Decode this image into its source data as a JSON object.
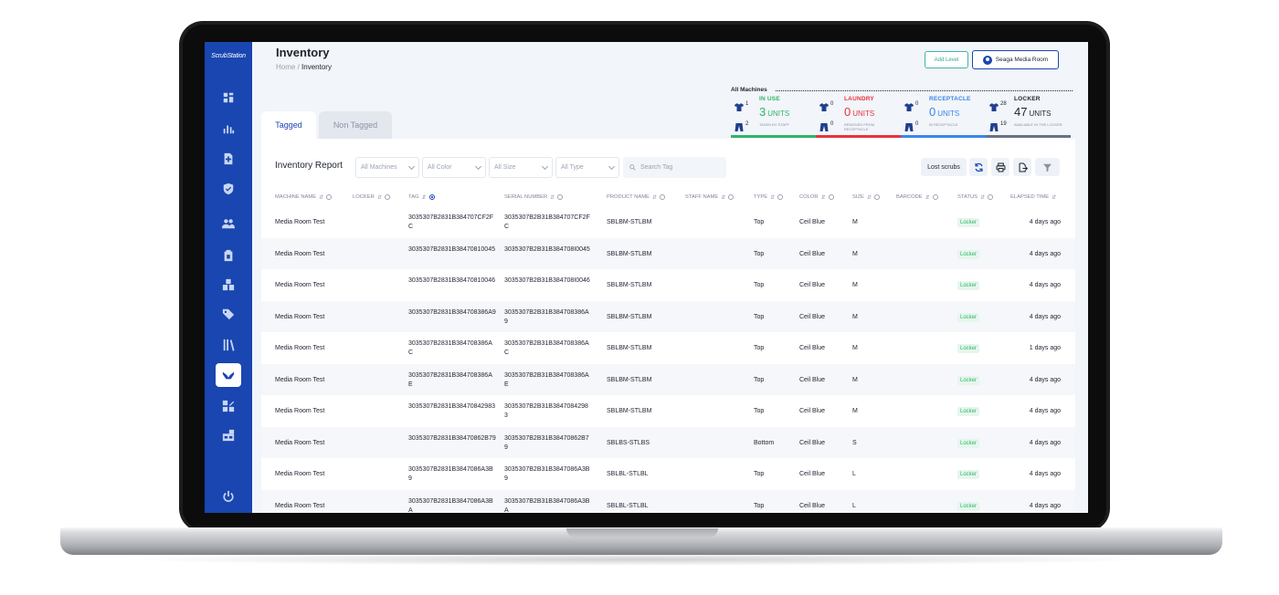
{
  "app": {
    "logo_text": "ScrubStation",
    "page_title": "Inventory",
    "breadcrumb_home": "Home",
    "breadcrumb_sep": "/",
    "breadcrumb_current": "Inventory",
    "add_level_label": "Add Level",
    "room_label": "Seaga Media Room"
  },
  "sidebar": {
    "icons": [
      "dashboard-icon",
      "bar-chart-icon",
      "add-document-icon",
      "shield-check-icon",
      "users-icon",
      "clipboard-icon",
      "boxes-icon",
      "tags-icon",
      "library-icon",
      "inventory-icon",
      "sizes-icon",
      "machines-icon"
    ],
    "active": "inventory-icon",
    "logout_icon": "power-icon"
  },
  "summary": {
    "title": "All Machines",
    "stats": [
      {
        "label": "IN USE",
        "color": "#2fb56a",
        "value": "3",
        "unit": "UNITS",
        "sub": "TAKEN BY STAFF",
        "top_count": "1",
        "bottom_count": "2",
        "bar": "#2fb56a"
      },
      {
        "label": "LAUNDRY",
        "color": "#e8333d",
        "value": "0",
        "unit": "UNITS",
        "sub": "REMOVED FROM RECEPTACLE",
        "top_count": "0",
        "bottom_count": "0",
        "bar": "#e8333d"
      },
      {
        "label": "RECEPTACLE",
        "color": "#3a86e8",
        "value": "0",
        "unit": "UNITS",
        "sub": "IN RECEPTACLE",
        "top_count": "0",
        "bottom_count": "0",
        "bar": "#3a86e8"
      },
      {
        "label": "LOCKER",
        "color": "#1d2330",
        "value": "47",
        "unit": "UNITS",
        "sub": "AVAILABLE IN THE LOCKER",
        "top_count": "28",
        "bottom_count": "19",
        "bar": "#6b7280"
      }
    ]
  },
  "tabs": [
    {
      "label": "Tagged",
      "active": true
    },
    {
      "label": "Non Tagged",
      "active": false
    }
  ],
  "report": {
    "title": "Inventory Report",
    "filters": [
      "All Machines",
      "All Color",
      "All Size",
      "All Type"
    ],
    "search_placeholder": "Search Tag",
    "lost_scrubs_label": "Lost scrubs",
    "tool_icons": [
      "refresh-icon",
      "print-icon",
      "export-icon",
      "filter-icon"
    ]
  },
  "table": {
    "columns": [
      "MACHINE NAME",
      "LOCKER",
      "TAG",
      "SERIAL NUMBER",
      "PRODUCT NAME",
      "STAFF NAME",
      "TYPE",
      "COLOR",
      "SIZE",
      "BARCODE",
      "STATUS",
      "ELAPSED TIME"
    ],
    "rows": [
      [
        "Media Room Test",
        "",
        "3035307B2831B384707CF2FC",
        "3035307B2B31B384707CF2FC",
        "SBLBM-STLBM",
        "",
        "Top",
        "Ceil Blue",
        "M",
        "",
        "Locker",
        "4 days ago"
      ],
      [
        "Media Room Test",
        "",
        "3035307B2831B38470810045",
        "3035307B2B31B384708I0045",
        "SBLBM-STLBM",
        "",
        "Top",
        "Ceil Blue",
        "M",
        "",
        "Locker",
        "4 days ago"
      ],
      [
        "Media Room Test",
        "",
        "3035307B2831B38470810046",
        "3035307B2B31B384708I0046",
        "SBLBM-STLBM",
        "",
        "Top",
        "Ceil Blue",
        "M",
        "",
        "Locker",
        "4 days ago"
      ],
      [
        "Media Room Test",
        "",
        "3035307B2831B384708386A9",
        "3035307B2B31B384708386A9",
        "SBLBM-STLBM",
        "",
        "Top",
        "Ceil Blue",
        "M",
        "",
        "Locker",
        "4 days ago"
      ],
      [
        "Media Room Test",
        "",
        "3035307B2831B384708386AC",
        "3035307B2B31B384708386AC",
        "SBLBM-STLBM",
        "",
        "Top",
        "Ceil Blue",
        "M",
        "",
        "Locker",
        "1 days ago"
      ],
      [
        "Media Room Test",
        "",
        "3035307B2831B384708386AE",
        "3035307B2B31B384708386AE",
        "SBLBM-STLBM",
        "",
        "Top",
        "Ceil Blue",
        "M",
        "",
        "Locker",
        "4 days ago"
      ],
      [
        "Media Room Test",
        "",
        "3035307B2831B38470842983",
        "3035307B2B31B3847084298 3",
        "SBLBM-STLBM",
        "",
        "Top",
        "Ceil Blue",
        "M",
        "",
        "Locker",
        "4 days ago"
      ],
      [
        "Media Room Test",
        "",
        "3035307B2831B38470862B79",
        "3035307B2B31B38470862B79",
        "SBLBS-STLBS",
        "",
        "Bottom",
        "Ceil Blue",
        "S",
        "",
        "Locker",
        "4 days ago"
      ],
      [
        "Media Room Test",
        "",
        "3035307B2831B3847086A3B9",
        "3035307B2B31B3847086A3B9",
        "SBLBL-STLBL",
        "",
        "Top",
        "Ceil Blue",
        "L",
        "",
        "Locker",
        "4 days ago"
      ],
      [
        "Media Room Test",
        "",
        "3035307B2831B3847086A3BA",
        "3035307B2B31B3847086A3BA",
        "SBLBL-STLBL",
        "",
        "Top",
        "Ceil Blue",
        "L",
        "",
        "Locker",
        "4 days ago"
      ]
    ]
  }
}
